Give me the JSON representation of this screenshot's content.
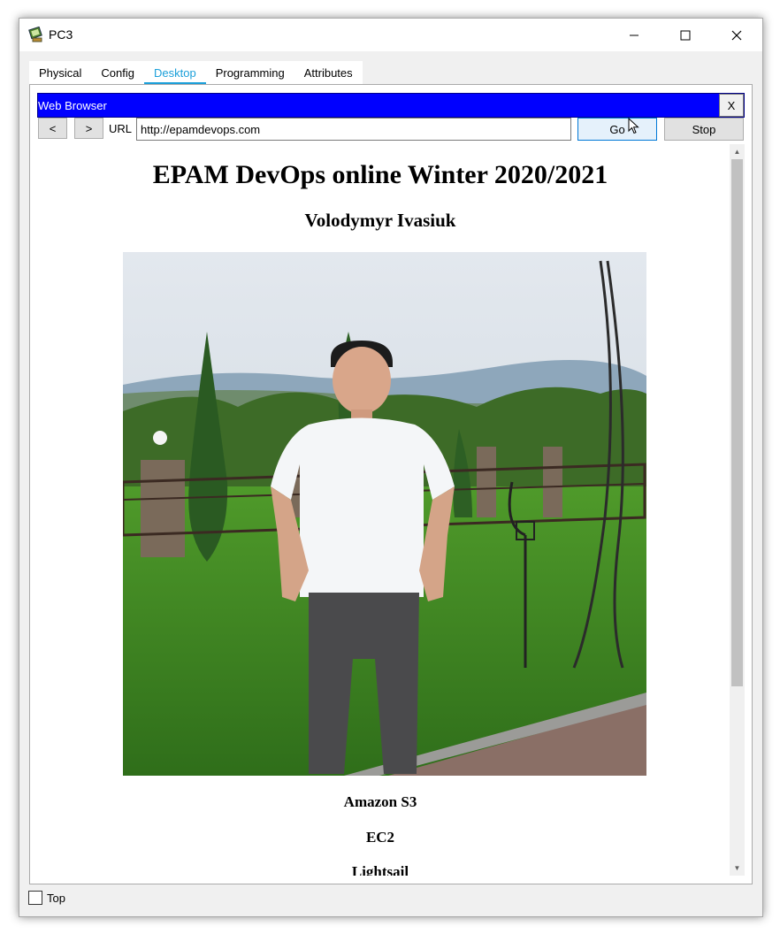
{
  "window": {
    "title": "PC3"
  },
  "tabs": [
    {
      "label": "Physical",
      "active": false
    },
    {
      "label": "Config",
      "active": false
    },
    {
      "label": "Desktop",
      "active": true
    },
    {
      "label": "Programming",
      "active": false
    },
    {
      "label": "Attributes",
      "active": false
    }
  ],
  "browser": {
    "title": "Web Browser",
    "close_label": "X",
    "back_label": "<",
    "forward_label": ">",
    "url_label": "URL",
    "url_value": "http://epamdevops.com",
    "go_label": "Go",
    "stop_label": "Stop"
  },
  "page": {
    "heading": "EPAM DevOps online Winter 2020/2021",
    "subheading": "Volodymyr Ivasiuk",
    "services": [
      "Amazon S3",
      "EC2",
      "Lightsail"
    ]
  },
  "footer": {
    "top_label": "Top",
    "top_checked": false
  },
  "colors": {
    "accent": "#1a9fd9",
    "browser_bar": "#0000ff"
  }
}
